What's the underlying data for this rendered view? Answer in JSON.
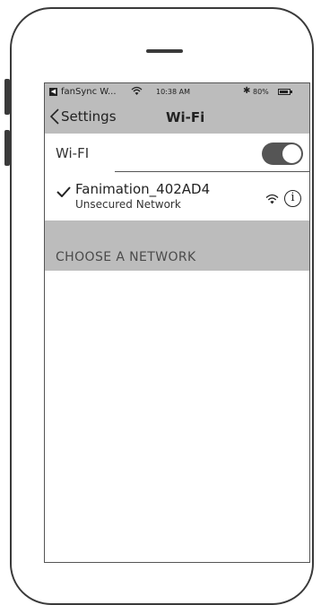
{
  "status_bar": {
    "app_name": "fanSync W...",
    "time": "10:38 AM",
    "battery": "80%",
    "app_icon": "back-app-icon",
    "wifi_icon": "wifi-icon",
    "bluetooth_icon": "bluetooth-icon",
    "battery_icon": "battery-icon"
  },
  "nav": {
    "back_label": "Settings",
    "title": "Wi-Fi"
  },
  "wifi": {
    "label": "Wi-FI",
    "enabled": true
  },
  "network": {
    "name": "Fanimation_402AD4",
    "security": "Unsecured Network",
    "connected": true
  },
  "section": {
    "title": "CHOOSE A NETWORK"
  },
  "colors": {
    "frame": "#3a3a3a",
    "header_bg": "#bcbcbc",
    "toggle_on": "#555555"
  }
}
